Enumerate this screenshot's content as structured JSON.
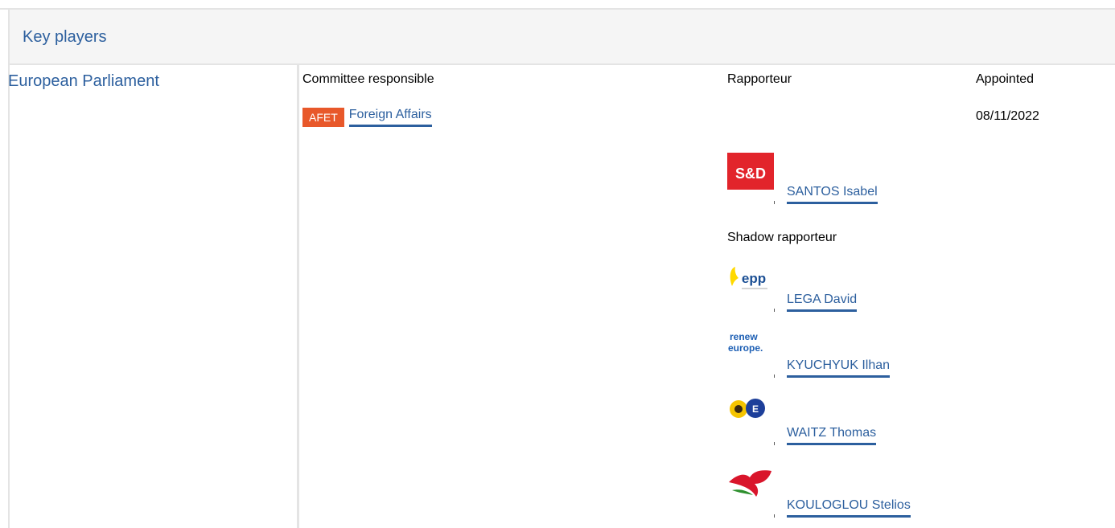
{
  "section": {
    "title": "Key players"
  },
  "institution": {
    "name": "European Parliament"
  },
  "columns": {
    "committee": "Committee responsible",
    "rapporteur": "Rapporteur",
    "appointed": "Appointed"
  },
  "committee": {
    "code": "AFET",
    "name": "Foreign Affairs",
    "appointed": "08/11/2022"
  },
  "rapporteur": {
    "name": "SANTOS Isabel",
    "group_logo": "sd-logo",
    "group_logo_text": "S&D"
  },
  "shadow_label": "Shadow rapporteur",
  "shadows": [
    {
      "name": "LEGA David",
      "group_logo": "epp-logo",
      "group_logo_text": "epp"
    },
    {
      "name": "KYUCHYUK Ilhan",
      "group_logo": "renew-europe-logo",
      "group_logo_text": "renew europe."
    },
    {
      "name": "WAITZ Thomas",
      "group_logo": "greens-efa-logo"
    },
    {
      "name": "KOULOGLOU Stelios",
      "group_logo": "left-logo"
    }
  ],
  "colors": {
    "link": "#2c5f9e",
    "badge": "#e8582a",
    "sd": "#e2242b",
    "renew": "#1d5fb4"
  }
}
